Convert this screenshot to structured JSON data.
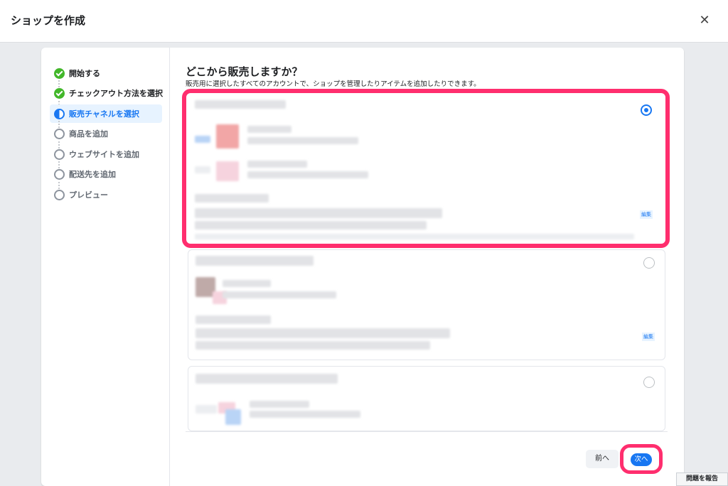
{
  "dialog": {
    "title": "ショップを作成",
    "close_icon": "✕"
  },
  "steps": [
    {
      "label": "開始する",
      "state": "done"
    },
    {
      "label": "チェックアウト方法を選択",
      "state": "done"
    },
    {
      "label": "販売チャネルを選択",
      "state": "active"
    },
    {
      "label": "商品を追加",
      "state": "todo"
    },
    {
      "label": "ウェブサイトを追加",
      "state": "todo"
    },
    {
      "label": "配送先を追加",
      "state": "todo"
    },
    {
      "label": "プレビュー",
      "state": "todo"
    }
  ],
  "main": {
    "heading": "どこから販売しますか？",
    "subheading": "販売用に選択したすべてのアカウントで、ショップを管理したりアイテムを追加したりできます。",
    "options": [
      {
        "selected": true,
        "edit_label": "編集"
      },
      {
        "selected": false,
        "edit_label": "編集"
      },
      {
        "selected": false
      }
    ]
  },
  "footer": {
    "prev_label": "前へ",
    "next_label": "次へ"
  },
  "report_label": "問題を報告",
  "colors": {
    "accent": "#1877f2",
    "highlight": "#ff2e6e",
    "success": "#42b72a"
  }
}
